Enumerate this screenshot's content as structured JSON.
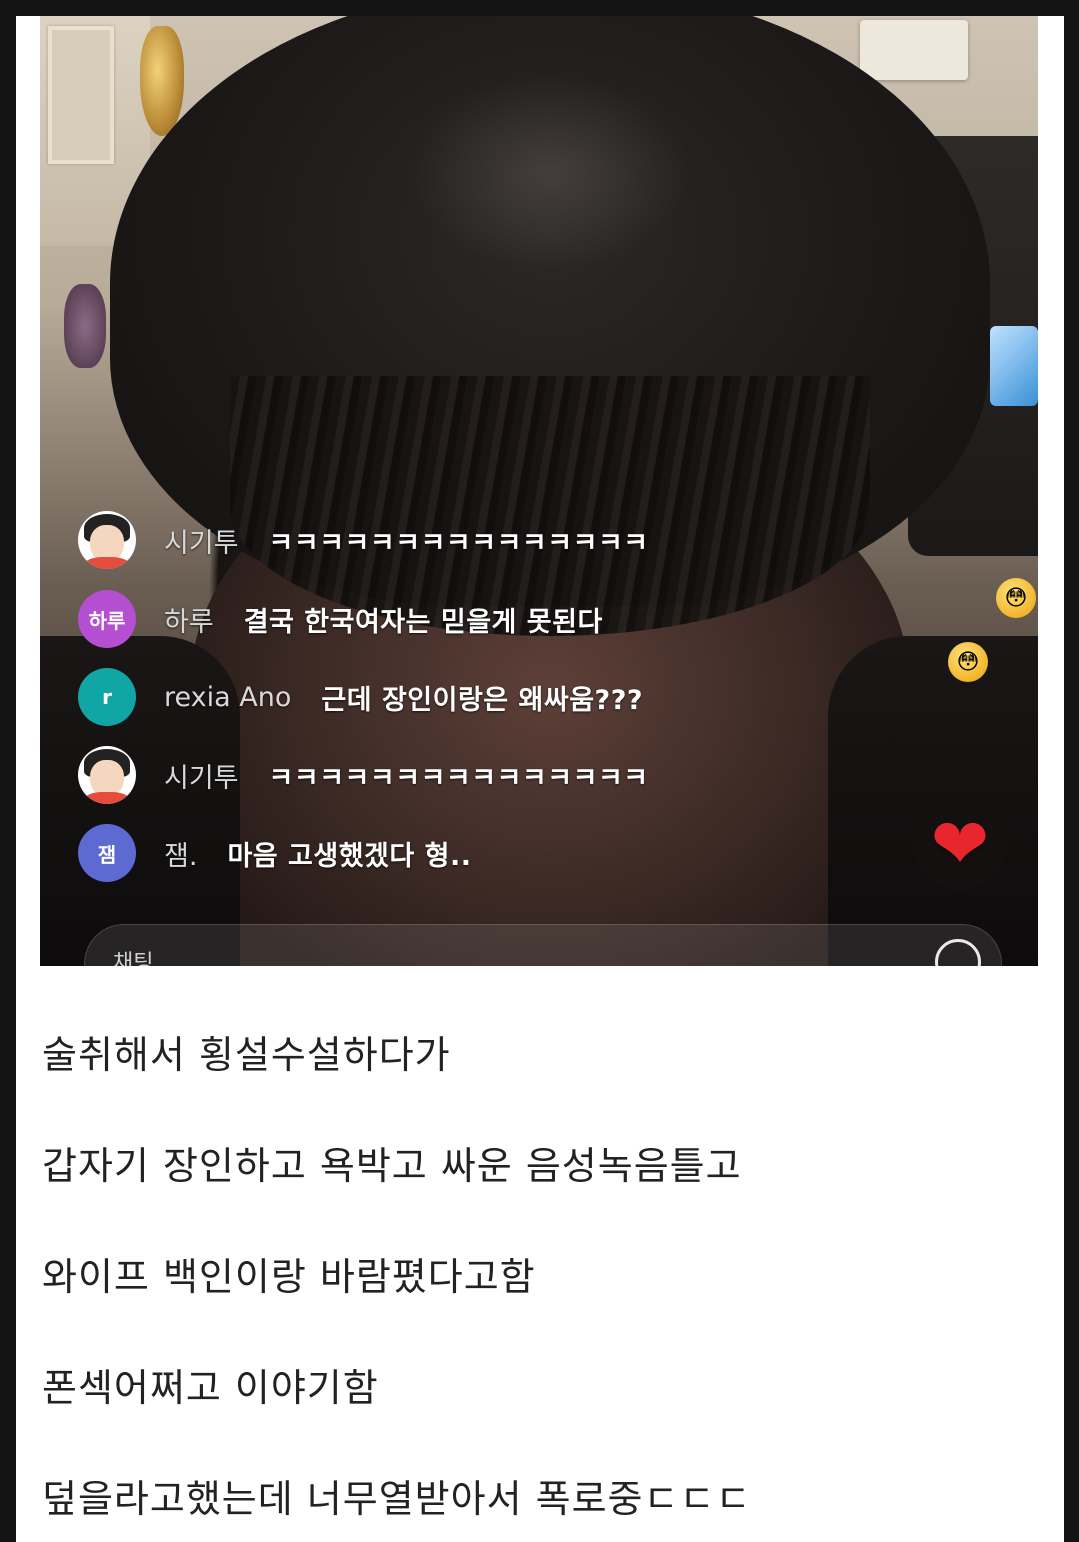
{
  "stream": {
    "chat": [
      {
        "avatar": "face-avatar",
        "avatar_text": "",
        "nickname": "시기투",
        "message": "ㅋㅋㅋㅋㅋㅋㅋㅋㅋㅋㅋㅋㅋㅋㅋ"
      },
      {
        "avatar": "letter-avatar",
        "avatar_text": "하루",
        "nickname": "하루",
        "message": "결국 한국여자는 믿을게 못된다"
      },
      {
        "avatar": "letter-avatar",
        "avatar_text": "r",
        "nickname": "rexia Ano",
        "message": "근데 장인이랑은 왜싸움???"
      },
      {
        "avatar": "face-avatar",
        "avatar_text": "",
        "nickname": "시기투",
        "message": "ㅋㅋㅋㅋㅋㅋㅋㅋㅋㅋㅋㅋㅋㅋㅋ"
      },
      {
        "avatar": "letter-avatar",
        "avatar_text": "잼",
        "nickname": "잼.",
        "message": "마음 고생했겠다 형.."
      }
    ],
    "reactions": [
      "😳",
      "😳"
    ],
    "comment_placeholder": "채팅",
    "heart_icon": "heart-icon",
    "colors": {
      "heart": "#e8262e",
      "avatar_purple": "#b34fd0",
      "avatar_teal": "#11a6a6",
      "avatar_indigo": "#5d6ad2"
    }
  },
  "captions": [
    "술취해서 횡설수설하다가",
    "갑자기 장인하고 욕박고 싸운 음성녹음틀고",
    "와이프 백인이랑 바람폈다고함",
    "폰섹어쩌고 이야기함",
    "덮을라고했는데 너무열받아서 폭로중ㄷㄷㄷ"
  ]
}
